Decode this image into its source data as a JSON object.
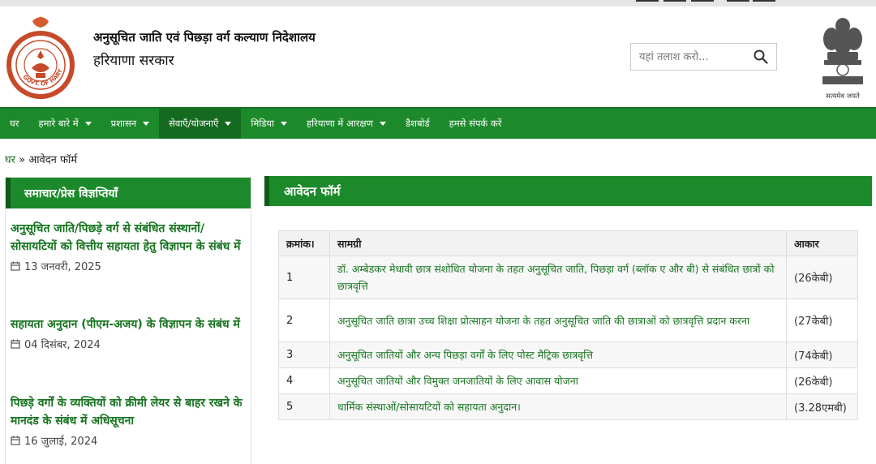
{
  "header": {
    "department_title": "अनुसूचित जाति एवं पिछड़ा वर्ग कल्याण निदेशालय",
    "government": "हरियाणा सरकार",
    "left_logo": "haryana-state-seal",
    "left_logo_text": "GOVT. OF HARYANA",
    "right_logo": "national-emblem",
    "emblem_motto": "सत्यमेव जयते",
    "search_placeholder": "यहां तलाश करो...",
    "search_icon": "search-icon"
  },
  "nav": {
    "items": [
      {
        "label": "घर",
        "has_dropdown": false
      },
      {
        "label": "हमारे बारे में",
        "has_dropdown": true
      },
      {
        "label": "प्रशासन",
        "has_dropdown": true
      },
      {
        "label": "सेवाएँ/योजनाएँ",
        "has_dropdown": true,
        "active": true
      },
      {
        "label": "मिडिया",
        "has_dropdown": true
      },
      {
        "label": "हरियाणा में आरक्षण",
        "has_dropdown": true
      },
      {
        "label": "डैशबोर्ड",
        "has_dropdown": false
      },
      {
        "label": "हमसे संपर्क करें",
        "has_dropdown": false
      }
    ]
  },
  "breadcrumb": {
    "home": "घर",
    "separator": "»",
    "current": "आवेदन फॉर्म"
  },
  "sidebar": {
    "heading": "समाचार/प्रेस विज्ञप्तियाँ",
    "news": [
      {
        "title": "अनुसूचित जाति/पिछड़े वर्ग से संबंधित संस्थानों/सोसायटियों को वित्तीय सहायता हेतु विज्ञापन के संबंध में",
        "date": "13 जनवरी, 2025"
      },
      {
        "title": "सहायता अनुदान (पीएम-अजय) के विज्ञापन के संबंध में",
        "date": "04 दिसंबर, 2024"
      },
      {
        "title": "पिछड़े वर्गों के व्यक्तियों को क्रीमी लेयर से बाहर रखने के मानदंड के संबंध में अधिसूचना",
        "date": "16 जुलाई, 2024"
      }
    ]
  },
  "main": {
    "heading": "आवेदन फॉर्म",
    "table": {
      "headers": [
        "क्रमांक।",
        "सामग्री",
        "आकार"
      ],
      "rows": [
        {
          "num": "1",
          "title": "डॉ. अम्बेडकर मेधावी छात्र संशोधित योजना के तहत अनुसूचित जाति, पिछड़ा वर्ग (ब्लॉक ए और बी) से संबंधित छात्रों को छात्रवृत्ति",
          "size": "(26केबी)"
        },
        {
          "num": "2",
          "title": "अनुसूचित जाति छात्रा उच्च शिक्षा प्रोत्साहन योजना के तहत अनुसूचित जाति की छात्राओं को छात्रवृत्ति प्रदान करना",
          "size": "(27केबी)"
        },
        {
          "num": "3",
          "title": "अनुसूचित जातियों और अन्य पिछड़ा वर्गों के लिए पोस्ट मैट्रिक छात्रवृत्ति",
          "size": "(74केबी)"
        },
        {
          "num": "4",
          "title": "अनुसूचित जातियों और विमुक्त जनजातियों के लिए आवास योजना",
          "size": "(26केबी)"
        },
        {
          "num": "5",
          "title": "धार्मिक संस्थाओं/सोसायटियों को सहायता अनुदान।",
          "size": "(3.28एमबी)"
        }
      ]
    }
  },
  "colors": {
    "primary_green": "#1c8a2b",
    "dark_green": "#146a1f",
    "link_green": "#16741f"
  }
}
